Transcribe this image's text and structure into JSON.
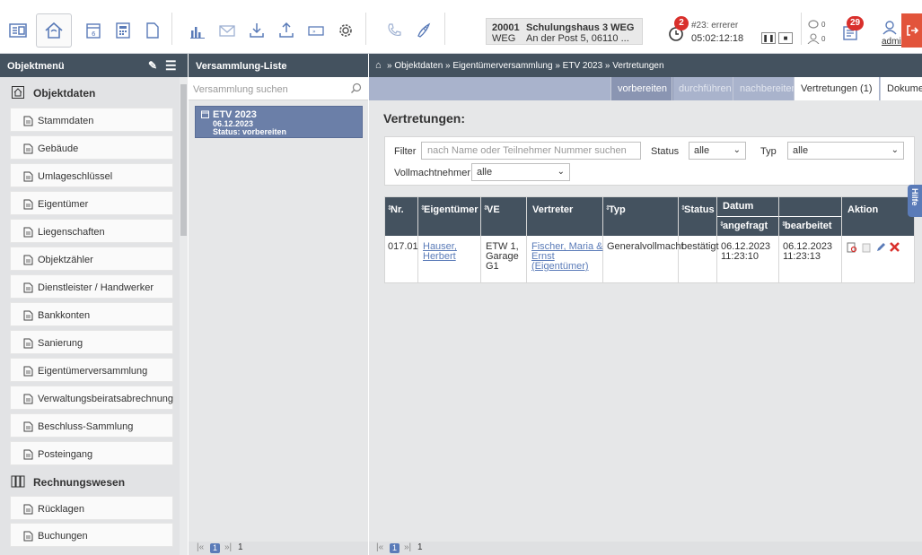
{
  "header": {
    "object_number": "20001",
    "object_type": "WEG",
    "object_name": "Schulungshaus 3 WEG",
    "object_address": "An der Post 5, 06110 ...",
    "timer_badge": "2",
    "timer_name": "#23: errerer",
    "timer_value": "05:02:12:18",
    "counter1": "0",
    "counter2": "0",
    "notes_badge": "29",
    "user": "admin"
  },
  "left_panel": {
    "title": "Objektmenü",
    "section1": "Objektdaten",
    "items": [
      "Stammdaten",
      "Gebäude",
      "Umlageschlüssel",
      "Eigentümer",
      "Liegenschaften",
      "Objektzähler",
      "Dienstleister / Handwerker",
      "Bankkonten",
      "Sanierung",
      "Eigentümerversammlung",
      "Verwaltungsbeiratsabrechnung",
      "Beschluss-Sammlung",
      "Posteingang"
    ],
    "section2": "Rechnungswesen",
    "items2": [
      "Rücklagen",
      "Buchungen"
    ]
  },
  "mid_panel": {
    "title": "Versammlung-Liste",
    "search_placeholder": "Versammlung suchen",
    "card_title": "ETV 2023",
    "card_date": "06.12.2023",
    "card_status": "Status: vorbereiten",
    "pager_page": "1",
    "pager_total": "1"
  },
  "breadcrumb": "» Objektdaten » Eigentümerversammlung » ETV 2023 » Vertretungen",
  "tabs": [
    "vorbereiten",
    "durchführen",
    "nachbereiten",
    "Vertretungen (1)",
    "Dokumente"
  ],
  "content": {
    "title": "Vertretungen:",
    "filter_label": "Filter",
    "filter_placeholder": "nach Name oder Teilnehmer Nummer suchen",
    "status_label": "Status",
    "status_value": "alle",
    "type_label": "Typ",
    "type_value": "alle",
    "proxy_label": "Vollmachtnehmer",
    "proxy_value": "alle",
    "pager_page": "1",
    "pager_total": "1"
  },
  "table": {
    "headers": {
      "nr": "Nr.",
      "owner": "Eigentümer",
      "ve": "VE",
      "rep": "Vertreter",
      "type": "Typ",
      "status": "Status",
      "date": "Datum",
      "requested": "angefragt",
      "processed": "bearbeitet",
      "action": "Aktion"
    },
    "rows": [
      {
        "nr": "017.01",
        "owner_line1": "Hauser,",
        "owner_line2": "Herbert",
        "ve_line1": "ETW 1,",
        "ve_line2": "Garage",
        "ve_line3": "G1",
        "rep_line1": "Fischer, Maria &",
        "rep_line2": "Ernst",
        "rep_line3": "(Eigentümer)",
        "type": "Generalvollmacht",
        "status": "bestätigt",
        "req_date": "06.12.2023",
        "req_time": "11:23:10",
        "proc_date": "06.12.2023",
        "proc_time": "11:23:13"
      }
    ]
  },
  "help_tab": "Hilfe"
}
